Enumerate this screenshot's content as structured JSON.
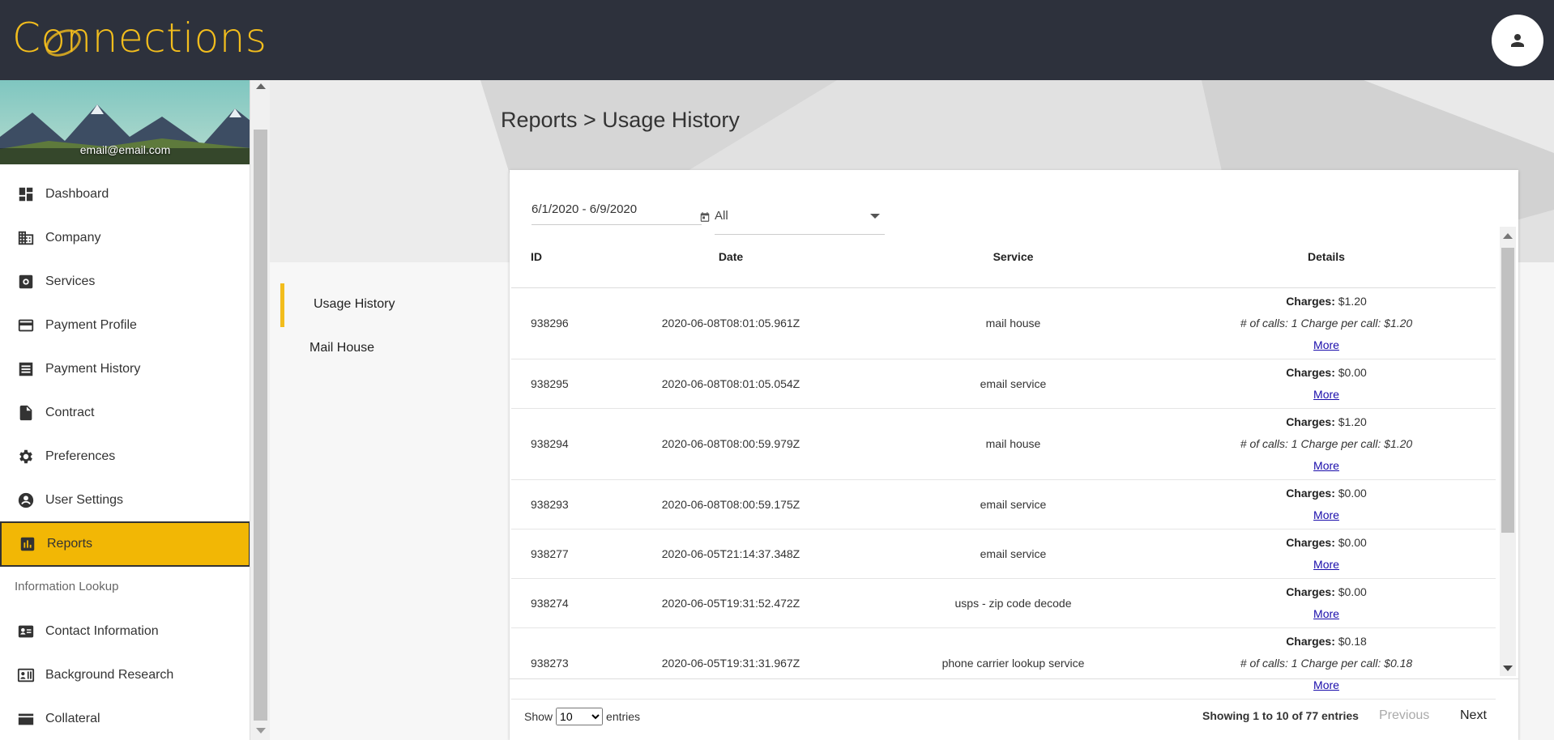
{
  "app": {
    "logo_text": "Connections"
  },
  "user": {
    "email": "email@email.com"
  },
  "sidebar": {
    "items": [
      {
        "label": "Dashboard",
        "icon": "dashboard-icon"
      },
      {
        "label": "Company",
        "icon": "building-icon"
      },
      {
        "label": "Services",
        "icon": "services-icon"
      },
      {
        "label": "Payment Profile",
        "icon": "credit-card-icon"
      },
      {
        "label": "Payment History",
        "icon": "receipt-icon"
      },
      {
        "label": "Contract",
        "icon": "document-icon"
      },
      {
        "label": "Preferences",
        "icon": "gear-icon"
      },
      {
        "label": "User Settings",
        "icon": "account-circle-icon"
      },
      {
        "label": "Reports",
        "icon": "bar-chart-icon",
        "active": true
      }
    ],
    "section_label": "Information Lookup",
    "lookup_items": [
      {
        "label": "Contact Information",
        "icon": "contact-card-icon"
      },
      {
        "label": "Background Research",
        "icon": "research-icon"
      },
      {
        "label": "Collateral",
        "icon": "collateral-icon"
      }
    ]
  },
  "page": {
    "title": "Reports > Usage History"
  },
  "subnav": {
    "items": [
      {
        "label": "Usage History",
        "active": true
      },
      {
        "label": "Mail House"
      }
    ]
  },
  "filters": {
    "date_range": "6/1/2020 - 6/9/2020",
    "service_filter": "All"
  },
  "table": {
    "headers": {
      "id": "ID",
      "date": "Date",
      "service": "Service",
      "details": "Details"
    },
    "charges_label": "Charges:",
    "more_label": "More",
    "rows": [
      {
        "id": "938296",
        "date": "2020-06-08T08:01:05.961Z",
        "service": "mail house",
        "charges": "$1.20",
        "calls": "# of calls: 1 Charge per call: $1.20"
      },
      {
        "id": "938295",
        "date": "2020-06-08T08:01:05.054Z",
        "service": "email service",
        "charges": "$0.00",
        "calls": ""
      },
      {
        "id": "938294",
        "date": "2020-06-08T08:00:59.979Z",
        "service": "mail house",
        "charges": "$1.20",
        "calls": "# of calls: 1 Charge per call: $1.20"
      },
      {
        "id": "938293",
        "date": "2020-06-08T08:00:59.175Z",
        "service": "email service",
        "charges": "$0.00",
        "calls": ""
      },
      {
        "id": "938277",
        "date": "2020-06-05T21:14:37.348Z",
        "service": "email service",
        "charges": "$0.00",
        "calls": ""
      },
      {
        "id": "938274",
        "date": "2020-06-05T19:31:52.472Z",
        "service": "usps - zip code decode",
        "charges": "$0.00",
        "calls": ""
      },
      {
        "id": "938273",
        "date": "2020-06-05T19:31:31.967Z",
        "service": "phone carrier lookup service",
        "charges": "$0.18",
        "calls": "# of calls: 1 Charge per call: $0.18"
      }
    ]
  },
  "pagination": {
    "show_label": "Show",
    "page_size": "10",
    "entries_label": "entries",
    "summary": "Showing 1 to 10 of 77 entries",
    "previous": "Previous",
    "next": "Next"
  },
  "colors": {
    "topbar": "#2d313c",
    "accent": "#f2bd1d",
    "active_nav": "#f2b705"
  }
}
